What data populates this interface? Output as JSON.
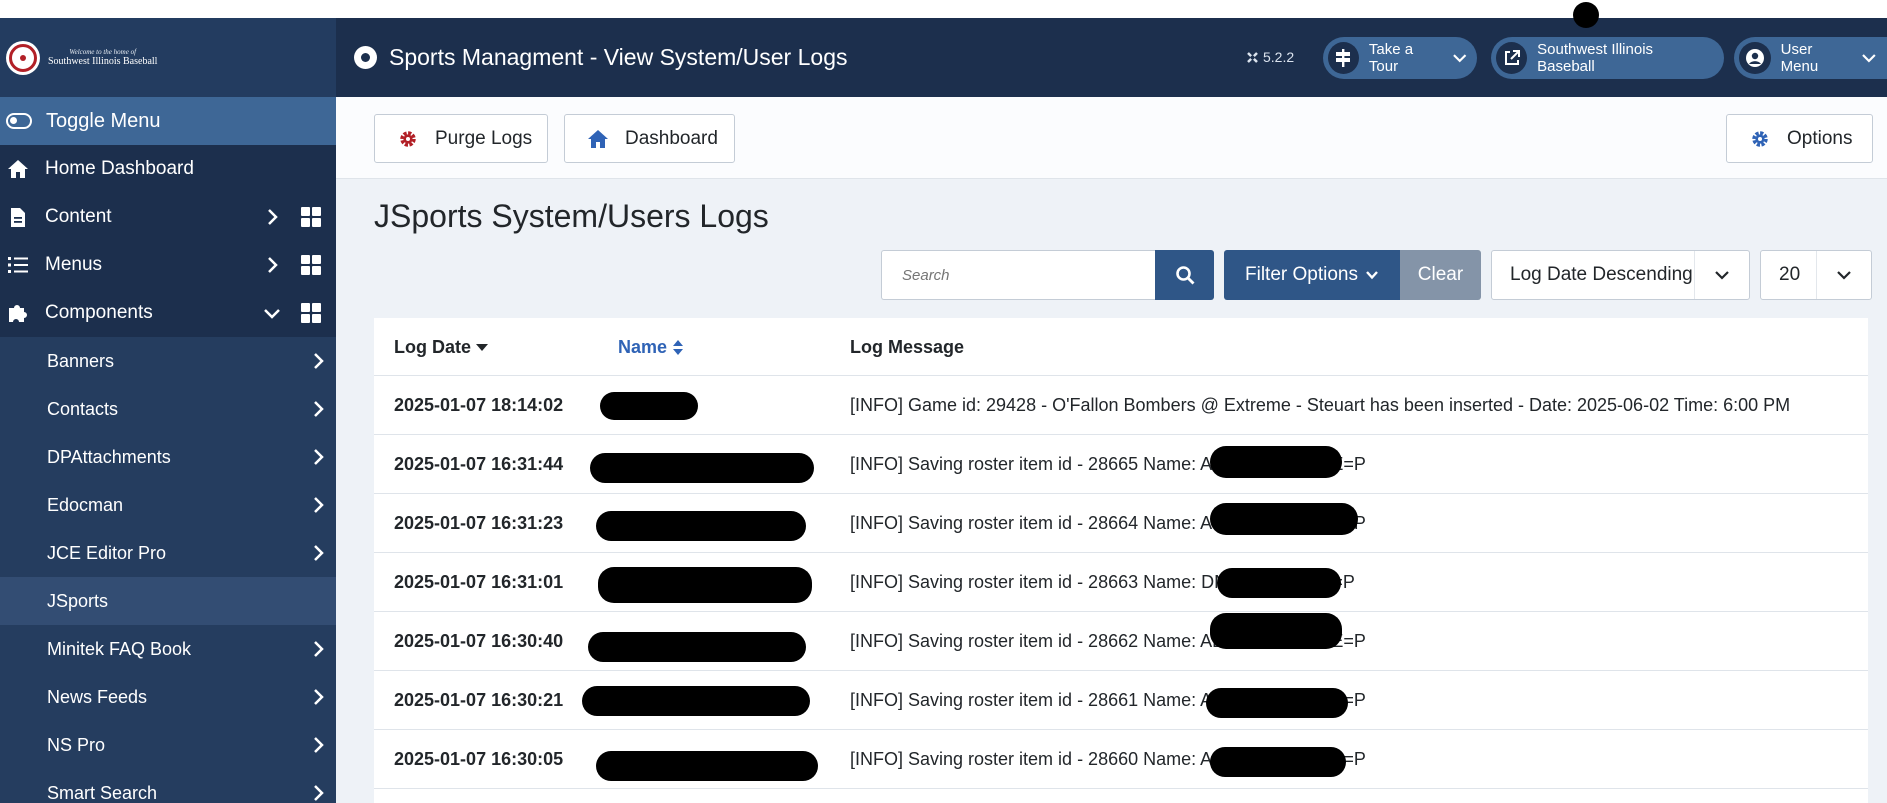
{
  "logo": {
    "line1": "Welcome to the home of",
    "line2": "Southwest Illinois Baseball"
  },
  "sidebar": {
    "toggle_label": "Toggle Menu",
    "items": [
      {
        "label": "Home Dashboard",
        "icon": "home-icon"
      },
      {
        "label": "Content",
        "icon": "file-icon"
      },
      {
        "label": "Menus",
        "icon": "list-icon"
      },
      {
        "label": "Components",
        "icon": "puzzle-icon"
      }
    ],
    "components": [
      {
        "label": "Banners"
      },
      {
        "label": "Contacts"
      },
      {
        "label": "DPAttachments"
      },
      {
        "label": "Edocman"
      },
      {
        "label": "JCE Editor Pro"
      },
      {
        "label": "JSports"
      },
      {
        "label": "Minitek FAQ Book"
      },
      {
        "label": "News Feeds"
      },
      {
        "label": "NS Pro"
      },
      {
        "label": "Smart Search"
      }
    ]
  },
  "header": {
    "title": "Sports Managment - View System/User Logs",
    "version": "5.2.2",
    "tour_label": "Take a Tour",
    "site_label": "Southwest Illinois Baseball",
    "user_label": "User Menu"
  },
  "toolbar": {
    "purge_label": "Purge Logs",
    "dashboard_label": "Dashboard",
    "options_label": "Options"
  },
  "main": {
    "title": "JSports System/Users Logs",
    "search_placeholder": "Search",
    "filter_label": "Filter Options",
    "clear_label": "Clear",
    "sort_value": "Log Date Descending",
    "limit_value": "20"
  },
  "table": {
    "headers": {
      "date": "Log Date",
      "name": "Name",
      "message": "Log Message"
    },
    "rows": [
      {
        "date": "2025-01-07 18:14:02",
        "message": "[INFO] Game id: 29428 - O'Fallon Bombers @ Extreme - Steuart has been inserted - Date: 2025-06-02 Time: 6:00 PM"
      },
      {
        "date": "2025-01-07 16:31:44",
        "message": "[INFO] Saving roster item id - 28665 Name:                 ADMIN=No TYPE=P"
      },
      {
        "date": "2025-01-07 16:31:23",
        "message": "[INFO] Saving roster item id - 28664 Name:                 ADMIN=No TYPE=P"
      },
      {
        "date": "2025-01-07 16:31:01",
        "message": "[INFO] Saving roster item id - 28663 Name:                DMIN=No TYPE=P"
      },
      {
        "date": "2025-01-07 16:30:40",
        "message": "[INFO] Saving roster item id - 28662 Name:                 ADMIN=No TYPE=P"
      },
      {
        "date": "2025-01-07 16:30:21",
        "message": "[INFO] Saving roster item id - 28661 Name:                  ADMIN=No TYPE=P"
      },
      {
        "date": "2025-01-07 16:30:05",
        "message": "[INFO] Saving roster item id - 28660 Name:                  ADMIN=No TYPE=P"
      }
    ]
  }
}
